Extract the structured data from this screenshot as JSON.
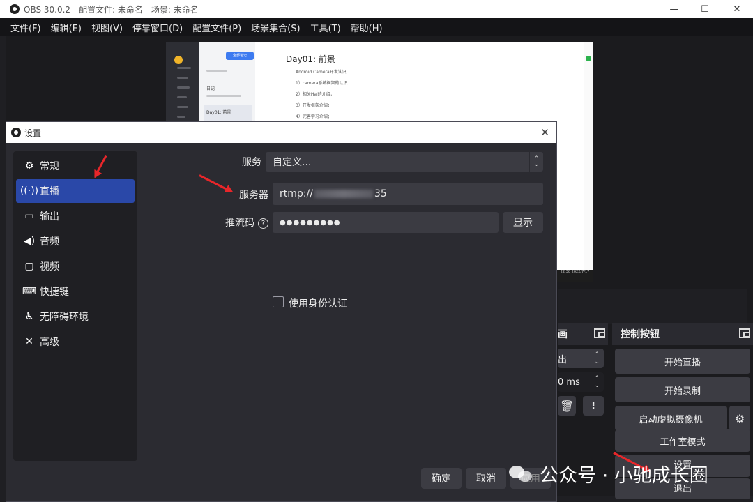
{
  "window": {
    "title": "OBS 30.0.2 - 配置文件: 未命名 - 场景: 未命名",
    "minimize": "—",
    "maximize": "☐",
    "close": "✕"
  },
  "menubar": [
    "文件(F)",
    "编辑(E)",
    "视图(V)",
    "停靠窗口(D)",
    "配置文件(P)",
    "场景集合(S)",
    "工具(T)",
    "帮助(H)"
  ],
  "preview": {
    "heading": "Day01: 前景",
    "lines": [
      "Android Camera开发认识:",
      "1）camera系统框架的认识",
      "2）相关Hal的介绍；",
      "3）开发框架介绍；",
      "4）完善学习介绍；"
    ],
    "list_items": [
      "全部笔记",
      "日记",
      "Day01: 前景"
    ],
    "taskbar": "22:30 2022/7/17"
  },
  "transition_panel": {
    "title_fragment": "画",
    "select_value": "出",
    "duration": "0 ms"
  },
  "controls": {
    "title": "控制按钮",
    "buttons": [
      "开始直播",
      "开始录制",
      "启动虚拟摄像机",
      "工作室模式",
      "设置",
      "退出"
    ]
  },
  "dialog": {
    "title": "设置",
    "close": "✕",
    "nav": [
      {
        "label": "常规",
        "icon": "gear-icon"
      },
      {
        "label": "直播",
        "icon": "broadcast-icon"
      },
      {
        "label": "输出",
        "icon": "output-icon"
      },
      {
        "label": "音频",
        "icon": "speaker-icon"
      },
      {
        "label": "视频",
        "icon": "monitor-icon"
      },
      {
        "label": "快捷键",
        "icon": "keyboard-icon"
      },
      {
        "label": "无障碍环境",
        "icon": "accessibility-icon"
      },
      {
        "label": "高级",
        "icon": "tools-icon"
      }
    ],
    "active_nav": "直播",
    "service_label": "服务",
    "service_value": "自定义...",
    "server_label": "服务器",
    "server_prefix": "rtmp://",
    "server_suffix": "35",
    "streamkey_label": "推流码",
    "streamkey_value": "●●●●●●●●●",
    "show_button": "显示",
    "auth_checkbox": "使用身份认证",
    "ok_button": "确定",
    "cancel_button": "取消",
    "apply_button": "应用"
  },
  "watermark": "公众号 · 小驰成长圈",
  "colors": {
    "active_nav": "#2a48a8",
    "arrow": "#e8262a",
    "background": "#1f1f23"
  }
}
